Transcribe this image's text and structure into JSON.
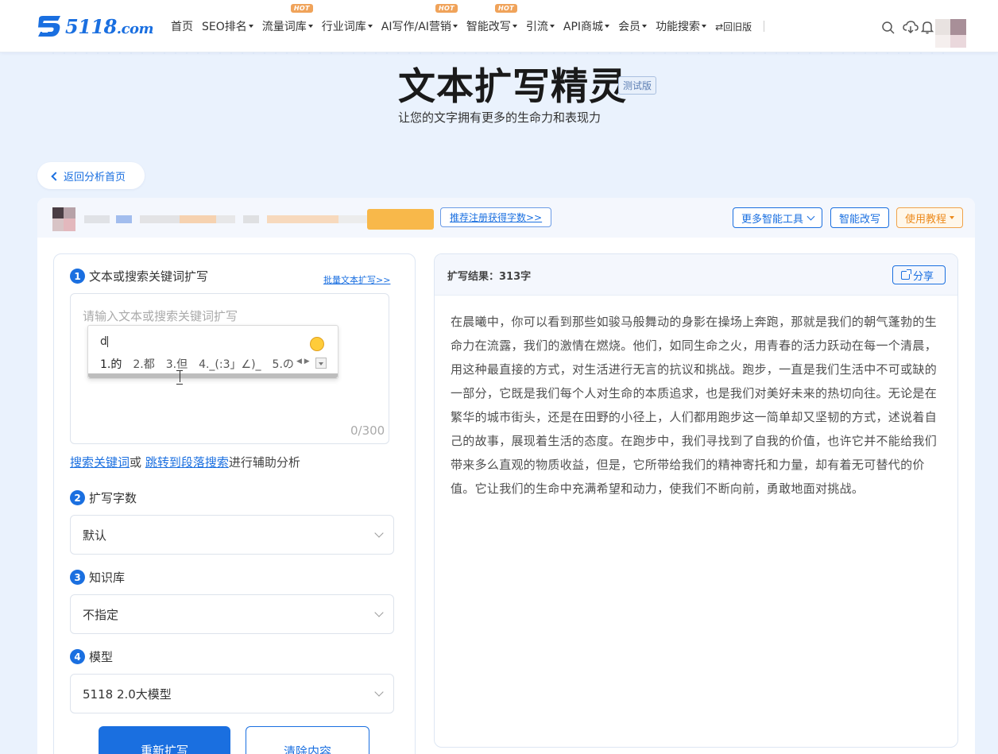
{
  "logo": {
    "text": "5118",
    "suffix": ".com"
  },
  "nav": {
    "items": [
      {
        "label": "首页",
        "dropdown": false,
        "hot": false
      },
      {
        "label": "SEO排名",
        "dropdown": true,
        "hot": false
      },
      {
        "label": "流量词库",
        "dropdown": true,
        "hot": true
      },
      {
        "label": "行业词库",
        "dropdown": true,
        "hot": false
      },
      {
        "label": "AI写作/AI营销",
        "dropdown": true,
        "hot": true
      },
      {
        "label": "智能改写",
        "dropdown": true,
        "hot": true
      },
      {
        "label": "引流",
        "dropdown": true,
        "hot": false
      },
      {
        "label": "API商城",
        "dropdown": true,
        "hot": false
      },
      {
        "label": "会员",
        "dropdown": true,
        "hot": false
      },
      {
        "label": "功能搜索",
        "dropdown": true,
        "hot": false
      }
    ],
    "hot_badge": "HOT",
    "old_version": "⇄回旧版",
    "icons": [
      "search-icon",
      "cloud-download-icon",
      "bell-icon"
    ]
  },
  "hero": {
    "title": "文本扩写精灵",
    "badge": "测试版",
    "subtitle": "让您的文字拥有更多的生命力和表现力"
  },
  "back_button": "返回分析首页",
  "user_bar": {
    "register_link": "推荐注册获得字数>>",
    "more_tools": "更多智能工具",
    "smart_rewrite": "智能改写",
    "tutorial": "使用教程"
  },
  "left": {
    "step1": {
      "num": "1",
      "label": "文本或搜索关键词扩写"
    },
    "batch_link": "批量文本扩写>>",
    "textarea_placeholder": "请输入文本或搜索关键词扩写",
    "counter": "0/300",
    "ime": {
      "input": "d",
      "candidates": [
        "1.的",
        "2.都",
        "3.但",
        "4._(:3」∠)_",
        "5.の"
      ]
    },
    "aux": {
      "link1": "搜索关键词",
      "or": "或",
      "link2": "跳转到段落搜索",
      "tail": "进行辅助分析"
    },
    "step2": {
      "num": "2",
      "label": "扩写字数"
    },
    "wordcount_value": "默认",
    "step3": {
      "num": "3",
      "label": "知识库"
    },
    "kb_value": "不指定",
    "step4": {
      "num": "4",
      "label": "模型"
    },
    "model_value": "5118 2.0大模型",
    "btn_rewrite": "重新扩写",
    "btn_clear": "清除内容"
  },
  "right": {
    "result_label": "扩写结果：313字",
    "share": "分享",
    "result_text": "在晨曦中，你可以看到那些如骏马般舞动的身影在操场上奔跑，那就是我们的朝气蓬勃的生命力在流露，我们的激情在燃烧。他们，如同生命之火，用青春的活力跃动在每一个清晨，用这种最直接的方式，对生活进行无言的抗议和挑战。跑步，一直是我们生活中不可或缺的一部分，它既是我们每个人对生命的本质追求，也是我们对美好未来的热切向往。无论是在繁华的城市街头，还是在田野的小径上，人们都用跑步这一简单却又坚韧的方式，述说着自己的故事，展现着生活的态度。在跑步中，我们寻找到了自我的价值，也许它并不能给我们带来多么直观的物质收益，但是，它所带给我们的精神寄托和力量，却有着无可替代的价值。它让我们的生命中充满希望和动力，使我们不断向前，勇敢地面对挑战。"
  },
  "colors": {
    "accent": "#1a6fe0",
    "orange": "#ec8a1c",
    "background": "#eaf2fd"
  }
}
